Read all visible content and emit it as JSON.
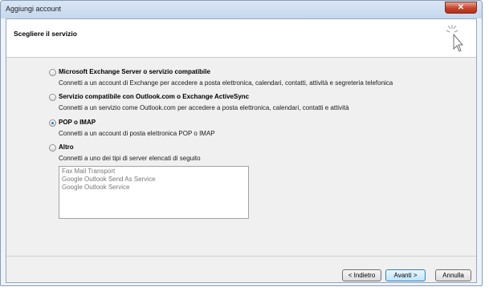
{
  "window": {
    "title": "Aggiungi account",
    "close_label": "✕"
  },
  "header": {
    "title": "Scegliere il servizio",
    "icon": "cursor-sparkle-icon"
  },
  "options": [
    {
      "label": "Microsoft Exchange Server o servizio compatibile",
      "description": "Connetti a un account di Exchange per accedere a posta elettronica, calendari, contatti, attività e segreteria telefonica",
      "checked": false
    },
    {
      "label": "Servizio compatibile con Outlook.com o Exchange ActiveSync",
      "description": "Connetti a un servizio come Outlook.com per accedere a posta elettronica, calendari, contatti e attività",
      "checked": false
    },
    {
      "label": "POP o IMAP",
      "description": "Connetti a un account di posta elettronica POP o IMAP",
      "checked": true
    },
    {
      "label": "Altro",
      "description": "Connetti a uno dei tipi di server elencati di seguito",
      "checked": false
    }
  ],
  "server_list": [
    "Fax Mail Transport",
    "Google Outlook Send As Service",
    "Google Outlook Service"
  ],
  "buttons": {
    "back": "< Indietro",
    "next": "Avanti >",
    "cancel": "Annulla"
  }
}
